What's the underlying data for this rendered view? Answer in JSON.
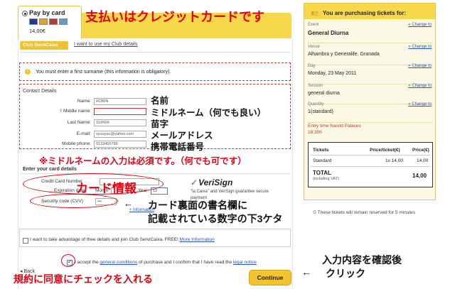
{
  "payment": {
    "method_label": "Pay by card",
    "price": "14,00€",
    "card_icons": [
      "visa-card-icon",
      "mastercard-icon",
      "maestro-icon",
      "amex-icon"
    ]
  },
  "club": {
    "logo_label": "Club ServiCaixa",
    "link": "I want to use my Club details"
  },
  "error": {
    "icon": "!",
    "message": "You must enter a first surname (this information is obligatory)."
  },
  "contact": {
    "title": "Contact Details",
    "fields": [
      {
        "label": "Name:",
        "value": "ROBIN",
        "error": false
      },
      {
        "label": "Middle name:",
        "value": "",
        "error": true
      },
      {
        "label": "Last Name:",
        "value": "SUPER",
        "error": false
      },
      {
        "label": "E-mail:",
        "value": "syuuyuu@yahoo.com",
        "error": false
      },
      {
        "label": "Mobile phone:",
        "value": "0123456789",
        "error": false
      }
    ]
  },
  "card": {
    "title": "Enter your card details",
    "number_label": "Credit Card Number",
    "expiration_label": "Expiration date:",
    "month_label": "Month",
    "month_value": "",
    "year_label": "Year:",
    "year_value": "12",
    "security_label": "Security code (CVV)",
    "security_value": "•••",
    "more_info": "+ information",
    "verisign": "VeriSign",
    "verisign_text_1": "\"la Caixa\" and VeriSign guarantee secure",
    "verisign_text_2": "payment"
  },
  "offer": {
    "text": "I want to take advantage of thee details and join Club ServiCaixa. FREE!",
    "link": "More Information"
  },
  "accept": {
    "text_1": "I accept the",
    "link_1": "general conditions",
    "text_2": "of purchase and I confirm that I have read the",
    "link_2": "legal notice",
    "checked": true
  },
  "nav": {
    "back": "Back",
    "continue": "Continue"
  },
  "summary": {
    "header": "You are purchasing tickets for:",
    "change": "Change to",
    "rows": [
      {
        "label": "Event",
        "value": "General Diurna"
      },
      {
        "label": "Venue",
        "value": "Alhambra y Generalife. Granada"
      },
      {
        "label": "Day",
        "value": "Monday, 23 May 2011"
      },
      {
        "label": "Session",
        "value": "general diurna"
      },
      {
        "label": "Quantity",
        "value": "1(standard)"
      }
    ],
    "entry_label": "Entry time Nasrid Palaces",
    "entry_time": "18:30h",
    "tickets_col": "Tickets",
    "price_ticket_col": "Price/ticket(€)",
    "price_col": "Price(€)",
    "ticket_type": "Standard",
    "ticket_qty": "1x 14,00",
    "ticket_price": "14,00",
    "total_label": "TOTAL",
    "total_vat": "(including VAT)",
    "total_value": "14,00",
    "reserve_note": "These tickets will remain reserved for 5 minutes"
  },
  "annotations": {
    "headline": "支払いはクレジットカードです",
    "name": "名前",
    "middle": "ミドルネーム（何でも良い）",
    "surname": "苗字",
    "email": "メールアドレス",
    "mobile": "携帯電話番号",
    "required_note": "※ミドルネームの入力は必須です。（何でも可です）",
    "card_info": "カード情報",
    "cvv_1": "カード裏面の書名欄に",
    "cvv_2": "記載されている数字の下3ケタ",
    "confirm_1": "入力内容を確認後",
    "confirm_arrow": "←",
    "confirm_2": "クリック",
    "agree": "規約に同意にチェックを入れる",
    "arrow_left": "←"
  },
  "colors": {
    "accent_yellow": "#f7d84a",
    "annotation_red": "#e60012",
    "link_blue": "#2a52be"
  }
}
